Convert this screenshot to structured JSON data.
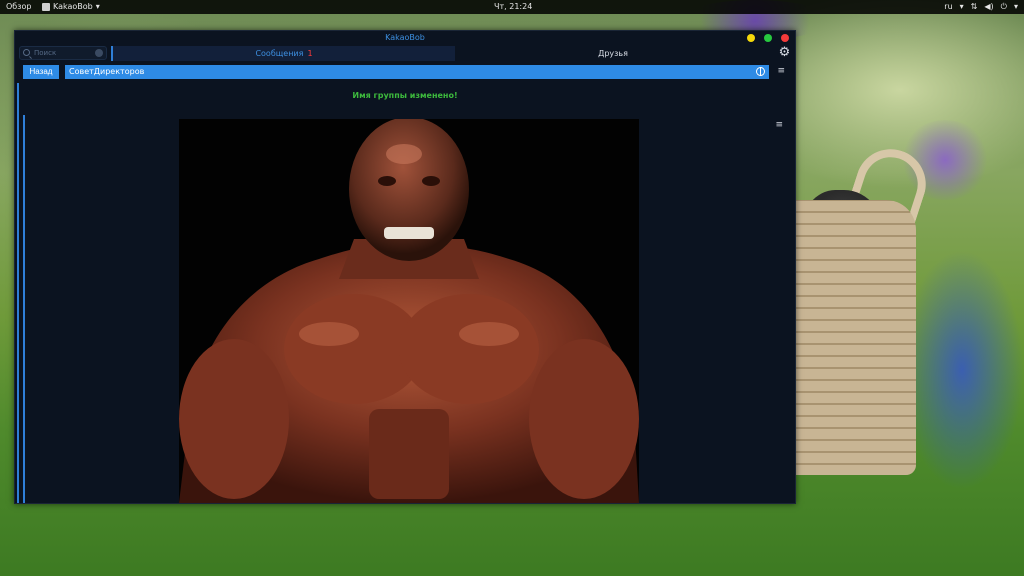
{
  "topbar": {
    "activities": "Обзор",
    "app_name": "KakaoBob",
    "app_arrow": "▾",
    "clock": "Чт, 21:24",
    "language": "ru",
    "language_arrow": "▾",
    "network_icon": "network-icon",
    "volume_icon": "volume-icon",
    "power_icon": "power-icon",
    "power_arrow": "▾"
  },
  "window": {
    "title": "KakaoBob",
    "buttons": [
      "minimize",
      "maximize",
      "close"
    ],
    "colors": {
      "minimize": "#f5d90a",
      "maximize": "#27c93f",
      "close": "#f23a3a"
    }
  },
  "tabs": {
    "search_placeholder": "Поиск",
    "messages_label": "Сообщения",
    "messages_badge": "1",
    "friends_label": "Друзья",
    "settings_icon": "gear-icon"
  },
  "chat": {
    "back_label": "Назад",
    "name": "СоветДиректоров",
    "system_message": "Имя группы изменено!",
    "accent_color": "#2e8be6",
    "system_message_color": "#3dba3d"
  },
  "message": {
    "type": "image",
    "content": "photo of a bodybuilder on black background"
  }
}
